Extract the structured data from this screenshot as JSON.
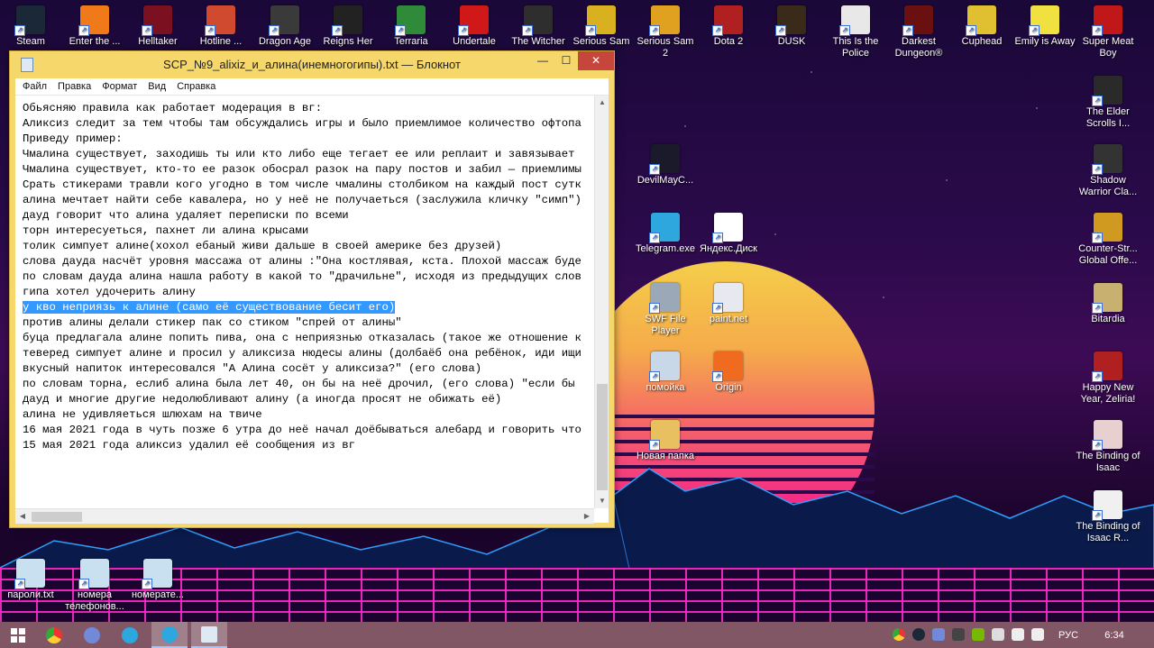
{
  "desktop": {
    "top_icons": [
      {
        "label": "Steam",
        "icon": "steam-icon",
        "color": "#1b2838"
      },
      {
        "label": "Enter the ...",
        "icon": "enter-the-gungeon-icon",
        "color": "#f07a1a"
      },
      {
        "label": "Helltaker",
        "icon": "helltaker-icon",
        "color": "#7a1020"
      },
      {
        "label": "Hotline ...",
        "icon": "hotline-miami-icon",
        "color": "#d04a30"
      },
      {
        "label": "Dragon Age",
        "icon": "dragon-age-icon",
        "color": "#3a3a3a"
      },
      {
        "label": "Reigns Her",
        "icon": "reigns-icon",
        "color": "#222222"
      },
      {
        "label": "Terraria",
        "icon": "terraria-icon",
        "color": "#2f8a3a"
      },
      {
        "label": "Undertale",
        "icon": "undertale-icon",
        "color": "#d01818"
      },
      {
        "label": "The Witcher",
        "icon": "witcher-icon",
        "color": "#2e2e2e"
      },
      {
        "label": "Serious Sam ...",
        "icon": "serious-sam-icon",
        "color": "#d8b020"
      },
      {
        "label": "Serious Sam 2",
        "icon": "serious-sam-2-icon",
        "color": "#e0a020"
      },
      {
        "label": "Dota 2",
        "icon": "dota-2-icon",
        "color": "#b02020"
      },
      {
        "label": "DUSK",
        "icon": "dusk-icon",
        "color": "#3a2a1a"
      },
      {
        "label": "This Is the Police",
        "icon": "this-is-the-police-icon",
        "color": "#e8e8e8"
      },
      {
        "label": "Darkest Dungeon®",
        "icon": "darkest-dungeon-icon",
        "color": "#6a1010"
      },
      {
        "label": "Cuphead",
        "icon": "cuphead-icon",
        "color": "#e0c030"
      },
      {
        "label": "Emily is Away",
        "icon": "emily-is-away-icon",
        "color": "#f0e040"
      },
      {
        "label": "Super Meat Boy",
        "icon": "super-meat-boy-icon",
        "color": "#c01818"
      }
    ],
    "right_column_icons": [
      {
        "label": "The Elder Scrolls I...",
        "icon": "elder-scrolls-icon",
        "color": "#2a2a2a"
      },
      {
        "label": "Shadow Warrior Cla...",
        "icon": "shadow-warrior-icon",
        "color": "#333333"
      },
      {
        "label": "Counter-Str... Global Offe...",
        "icon": "counter-strike-icon",
        "color": "#d09a20"
      },
      {
        "label": "Bitardia",
        "icon": "bitardia-icon",
        "color": "#c8b070"
      },
      {
        "label": "Happy New Year, Zeliria!",
        "icon": "happy-new-year-icon",
        "color": "#b02020"
      },
      {
        "label": "The Binding of Isaac",
        "icon": "binding-of-isaac-icon",
        "color": "#e8d0d0"
      },
      {
        "label": "The Binding of Isaac R...",
        "icon": "binding-of-isaac-rebirth-icon",
        "color": "#f0f0f0"
      }
    ],
    "middle_icons": [
      {
        "label": "DevilMayC...",
        "icon": "devil-may-cry-icon",
        "color": "#1a1a2a"
      },
      {
        "label": "Telegram.exe",
        "icon": "telegram-icon",
        "color": "#2ea6de"
      },
      {
        "label": "Яндекс.Диск",
        "icon": "yandex-disk-icon",
        "color": "#ffffff"
      },
      {
        "label": "SWF File Player",
        "icon": "swf-player-icon",
        "color": "#9aa8b8"
      },
      {
        "label": "paint.net",
        "icon": "paint-net-icon",
        "color": "#e8e8f0"
      },
      {
        "label": "помойка",
        "icon": "recycle-bin-icon",
        "color": "#c8d8e8"
      },
      {
        "label": "Origin",
        "icon": "origin-icon",
        "color": "#f06a20"
      },
      {
        "label": "Новая папка",
        "icon": "folder-icon",
        "color": "#e8c060"
      }
    ],
    "bottom_icons": [
      {
        "label": "пароли.txt",
        "icon": "text-file-icon",
        "color": "#c8e0f0"
      },
      {
        "label": "номера телефонов...",
        "icon": "text-file-icon",
        "color": "#c8e0f0"
      },
      {
        "label": "номерате...",
        "icon": "text-file-icon",
        "color": "#c8e0f0"
      }
    ]
  },
  "window": {
    "title": "SCP_№9_alixiz_и_алина(инемногогипы).txt — Блокнот",
    "minimize": "—",
    "maximize": "☐",
    "close": "✕",
    "menu": [
      "Файл",
      "Правка",
      "Формат",
      "Вид",
      "Справка"
    ],
    "lines": [
      "Обьясняю правила как работает модерация в вг:",
      "Аликсиз следит за тем чтобы там обсуждались игры и было приемлимое количество офтопа",
      "Приведу пример:",
      "Чмалина существует, заходишь ты или кто либо еще тегает ее или реплаит и завязывает",
      "Чмалина существует, кто-то ее разок обосрал разок на пару постов и забил — приемлимы",
      "Срать стикерами травли кого угодно в том числе чмалины столбиком на каждый пост сутк",
      "алина мечтает найти себе кавалера, но у неё не получаеться (заслужила кличку \"симп\")",
      "дауд говорит что алина удаляет переписки по всеми",
      "торн интересуеться, пахнет ли алина крысами",
      "толик симпует алине(хохол ебаный живи дальше в своей америке без друзей)",
      "слова дауда насчёт уровня массажа от алины :\"Она костлявая, кста. Плохой массаж буде",
      "по словам дауда алина нашла работу в какой то \"драчильне\", исходя из предыдущих слов",
      "гипа хотел удочерить алину",
      "у кво неприязь к алине (само её существование бесит его)",
      "против алины делали стикер пак со стиком \"спрей от алины\"",
      "буца предлагала алине попить пива, она с неприязнью отказалась (такое же отношение к",
      "теверед симпует алине и просил у аликсиза нюдесы алины (долбаёб она ребёнок, иди ищи",
      "вкусный напиток интересовался \"А Алина сосёт у аликсиза?\" (его слова)",
      "по словам торна, еслиб алина была лет 40, он бы на неё дрочил, (его слова) \"если бы",
      "дауд и многие другие недолюбливают алину (а иногда просят не обижать её)",
      "алина не удивляеться шлюхам на твиче",
      "16 мая 2021 года в чуть позже 6 утра до неё начал доёбываться алебард и говорить что",
      "15 мая 2021 года аликсиз удалил её сообщения из вг"
    ],
    "selected_line_index": 13
  },
  "taskbar": {
    "apps": [
      {
        "name": "start-button",
        "color": "#ffffff"
      },
      {
        "name": "chrome-taskbar",
        "color": "#e0b020"
      },
      {
        "name": "discord-taskbar",
        "color": "#7289da"
      },
      {
        "name": "telegram-taskbar",
        "color": "#2ea6de"
      },
      {
        "name": "telegram-active-taskbar",
        "color": "#2ea6de"
      },
      {
        "name": "notepad-taskbar",
        "color": "#dfe9f4"
      }
    ],
    "lang": "РУС",
    "time": "6:34"
  }
}
